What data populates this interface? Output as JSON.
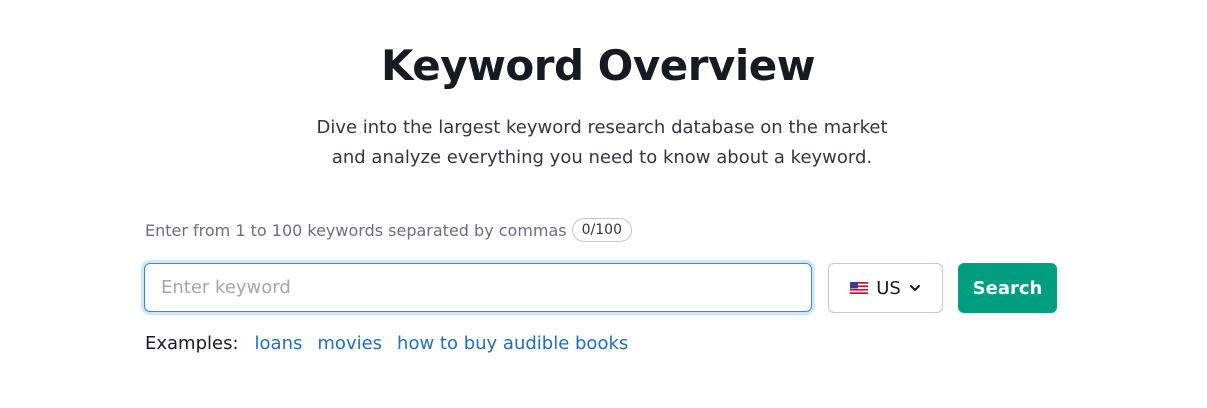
{
  "page": {
    "title": "Keyword Overview",
    "subtitle_line1": "Dive into the largest keyword research database on the market",
    "subtitle_line2": "and analyze everything you need to know about a keyword."
  },
  "form": {
    "hint": "Enter from 1 to 100 keywords separated by commas",
    "counter": "0/100",
    "input_value": "",
    "input_placeholder": "Enter keyword",
    "country": "US",
    "country_flag_icon": "us-flag-icon",
    "search_label": "Search",
    "accent_color": "#009f81",
    "focus_color": "#2b8ee6"
  },
  "examples": {
    "label": "Examples:",
    "items": [
      "loans",
      "movies",
      "how to buy audible books"
    ],
    "link_color": "#1e6fbf"
  }
}
